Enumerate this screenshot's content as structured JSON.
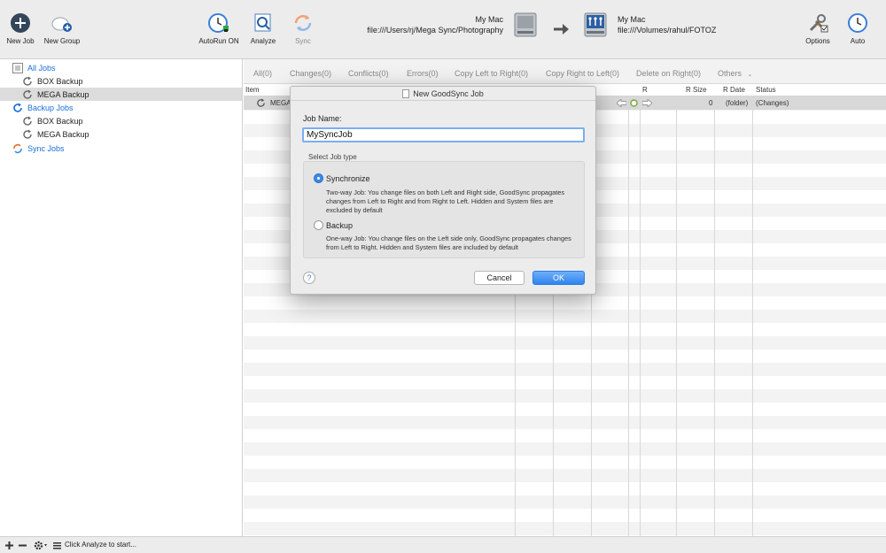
{
  "toolbar": {
    "new_job": "New Job",
    "new_group": "New Group",
    "autorun": "AutoRun ON",
    "analyze": "Analyze",
    "sync": "Sync",
    "options": "Options",
    "auto": "Auto"
  },
  "paths": {
    "left_title": "My Mac",
    "left_path": "file:///Users/rj/Mega Sync/Photography",
    "right_title": "My Mac",
    "right_path": "file:///Volumes/rahul/FOTOZ"
  },
  "sidebar": {
    "items": [
      {
        "label": "All Jobs"
      },
      {
        "label": "BOX Backup"
      },
      {
        "label": "MEGA Backup"
      },
      {
        "label": "Backup Jobs"
      },
      {
        "label": "BOX Backup"
      },
      {
        "label": "MEGA Backup"
      },
      {
        "label": "Sync Jobs"
      }
    ]
  },
  "filters": [
    "All(0)",
    "Changes(0)",
    "Conflicts(0)",
    "Errors(0)",
    "Copy Left to Right(0)",
    "Copy Right to Left(0)",
    "Delete on Right(0)",
    "Others"
  ],
  "table": {
    "headers": {
      "item": "Item",
      "r": "R",
      "r_size": "R Size",
      "r_date": "R Date",
      "status": "Status"
    },
    "row": {
      "name": "MEGA",
      "r_size": "0",
      "r_date": "(folder)",
      "status": "(Changes)"
    }
  },
  "dialog": {
    "title": "New GoodSync Job",
    "job_name_label": "Job Name:",
    "job_name_value": "MySyncJob",
    "select_type_label": "Select Job type",
    "option_sync": "Synchronize",
    "sync_desc": "Two-way Job: You change files on both Left and Right side, GoodSync propagates changes from Left to Right and from Right to Left.  Hidden and System files are excluded by default",
    "option_backup": "Backup",
    "backup_desc": "One-way Job: You change files on the Left side only, GoodSync propagates changes from Left to Right. Hidden and System files are included by default",
    "help": "?",
    "cancel": "Cancel",
    "ok": "OK"
  },
  "status": {
    "text": "Click Analyze to start..."
  },
  "colors": {
    "accent_blue": "#1a6ed8",
    "sync_orange": "#e8682a",
    "ok_button": "#2f84ef"
  }
}
